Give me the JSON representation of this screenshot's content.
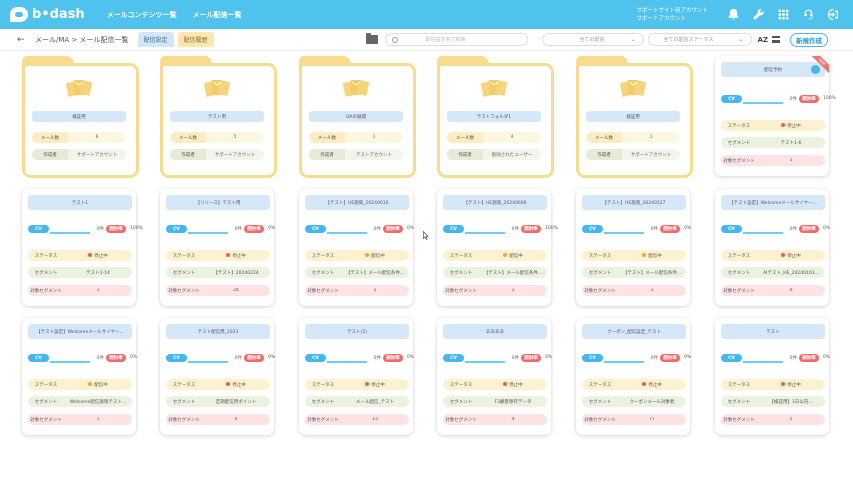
{
  "header": {
    "logo_text": "b•dash",
    "nav": [
      "メールコンテンツ一覧",
      "メール配信一覧"
    ],
    "support_lines": [
      "サポートサイト用アカウント",
      "サポートアカウント"
    ]
  },
  "subbar": {
    "back": "←",
    "breadcrumb": "メール/MA > メール配信一覧",
    "tab_a": "配信設定",
    "tab_b": "配信履歴",
    "search_placeholder": "配信設定名で検索",
    "filter1": "全ての配信",
    "filter2": "全ての配信ステータス",
    "sort": "AZ",
    "new_button": "新規作成"
  },
  "folders": [
    {
      "title": "検証用",
      "count_label": "メール数",
      "count": "6",
      "owner_label": "作成者",
      "owner": "サポートアカウント"
    },
    {
      "title": "テスト用",
      "count_label": "メール数",
      "count": "5",
      "owner_label": "作成者",
      "owner": "サポートアカウント"
    },
    {
      "title": "OAの展開",
      "count_label": "メール数",
      "count": "1",
      "owner_label": "作成者",
      "owner": "テストアカウント"
    },
    {
      "title": "テストフォルダ1",
      "count_label": "メール数",
      "count": "4",
      "owner_label": "作成者",
      "owner": "削除されたユーザー"
    },
    {
      "title": "検証用",
      "count_label": "メール数",
      "count": "1",
      "owner_label": "作成者",
      "owner": "サポートアカウント"
    }
  ],
  "cards": [
    {
      "title": "配信予約",
      "cv": "CV",
      "count": "0件",
      "status_pill": "開封率",
      "pct": "100%",
      "progress": 1.0,
      "row1_k": "ステータス",
      "row1_v": "停止中",
      "row1_dot": "red",
      "row2_k": "セグメント",
      "row2_v": "テスト1-6",
      "row3_k": "対象セグメント",
      "row3_v": "1",
      "ribbon": "NEW",
      "share": true
    },
    {
      "title": "テスト1",
      "cv": "CV",
      "count": "0件",
      "status_pill": "開封率",
      "pct": "100%",
      "progress": 1.0,
      "row1_k": "ステータス",
      "row1_v": "停止中",
      "row1_dot": "red",
      "row2_k": "セグメント",
      "row2_v": "テスト1-14",
      "row3_k": "対象セグメント",
      "row3_v": "1"
    },
    {
      "title": "【リリース】テスト用",
      "cv": "CV",
      "count": "0件",
      "status_pill": "開封率",
      "pct": "0%",
      "progress": 0.0,
      "row1_k": "ステータス",
      "row1_v": "停止中",
      "row1_dot": "red",
      "row2_k": "セグメント",
      "row2_v": "【テスト】20240224",
      "row3_k": "対象セグメント",
      "row3_v": "24"
    },
    {
      "title": "【テスト】HE施策_20240610",
      "cv": "CV",
      "count": "0件",
      "status_pill": "開封率",
      "pct": "0%",
      "progress": 0.0,
      "row1_k": "ステータス",
      "row1_v": "配信中",
      "row1_dot": "org",
      "row2_k": "セグメント",
      "row2_v": "【テスト】メール配信条件...",
      "row3_k": "対象セグメント",
      "row3_v": "1"
    },
    {
      "title": "【テスト】HE施策_20240606",
      "cv": "CV",
      "count": "0件",
      "status_pill": "開封率",
      "pct": "100%",
      "progress": 1.0,
      "row1_k": "ステータス",
      "row1_v": "配信中",
      "row1_dot": "org",
      "row2_k": "セグメント",
      "row2_v": "【テスト】メール配信条件...",
      "row3_k": "対象セグメント",
      "row3_v": "1"
    },
    {
      "title": "【テスト】HE施策_20240527",
      "cv": "CV",
      "count": "0件",
      "status_pill": "開封率",
      "pct": "0%",
      "progress": 0.0,
      "row1_k": "ステータス",
      "row1_v": "配信中",
      "row1_dot": "org",
      "row2_k": "セグメント",
      "row2_v": "【テスト】メール配信条件...",
      "row3_k": "対象セグメント",
      "row3_v": "1"
    },
    {
      "title": "【テスト設定】Welcomeメールサイヤー...",
      "cv": "CV",
      "count": "0件",
      "status_pill": "開封率",
      "pct": "0%",
      "progress": 0.0,
      "row1_k": "ステータス",
      "row1_v": "停止中",
      "row1_dot": "red",
      "row2_k": "セグメント",
      "row2_v": "AIテスト_HE_20240103...",
      "row3_k": "対象セグメント",
      "row3_v": "0"
    },
    {
      "title": "【テスト設定】Welcomeメールサイヤー...",
      "cv": "CV",
      "count": "0件",
      "status_pill": "開封率",
      "pct": "0%",
      "progress": 0.0,
      "row1_k": "ステータス",
      "row1_v": "配信中",
      "row1_dot": "org",
      "row2_k": "セグメント",
      "row2_v": "Welcome配信施策テスト...",
      "row3_k": "対象セグメント",
      "row3_v": "1"
    },
    {
      "title": "テスト配信用_2023",
      "cv": "CV",
      "count": "0件",
      "status_pill": "開封率",
      "pct": "0%",
      "progress": 0.0,
      "row1_k": "ステータス",
      "row1_v": "停止中",
      "row1_dot": "red",
      "row2_k": "セグメント",
      "row2_v": "定期配信用ポイント",
      "row3_k": "対象セグメント",
      "row3_v": "0"
    },
    {
      "title": "テスト(2)",
      "cv": "CV",
      "count": "0件",
      "status_pill": "開封率",
      "pct": "0%",
      "progress": 0.0,
      "row1_k": "ステータス",
      "row1_v": "停止中",
      "row1_dot": "red",
      "row2_k": "セグメント",
      "row2_v": "メール配信_テスト",
      "row3_k": "対象セグメント",
      "row3_v": "13"
    },
    {
      "title": "ああああ",
      "cv": "CV",
      "count": "0件",
      "status_pill": "開封率",
      "pct": "0%",
      "progress": 0.0,
      "row1_k": "ステータス",
      "row1_v": "停止中",
      "row1_dot": "red",
      "row2_k": "セグメント",
      "row2_v": "F3顧客保存データ",
      "row3_k": "対象セグメント",
      "row3_v": "4"
    },
    {
      "title": "クーポン_配信設定_テスト",
      "cv": "CV",
      "count": "0件",
      "status_pill": "開封率",
      "pct": "0%",
      "progress": 0.0,
      "row1_k": "ステータス",
      "row1_v": "停止中",
      "row1_dot": "red",
      "row2_k": "セグメント",
      "row2_v": "クーポンメール対象者",
      "row3_k": "対象セグメント",
      "row3_v": "77"
    },
    {
      "title": "テスト",
      "cv": "CV",
      "count": "0件",
      "status_pill": "開封率",
      "pct": "0%",
      "progress": 0.0,
      "row1_k": "ステータス",
      "row1_v": "停止中",
      "row1_dot": "red",
      "row2_k": "セグメント",
      "row2_v": "【検証用】1日以内...",
      "row3_k": "対象セグメント",
      "row3_v": "5"
    }
  ]
}
